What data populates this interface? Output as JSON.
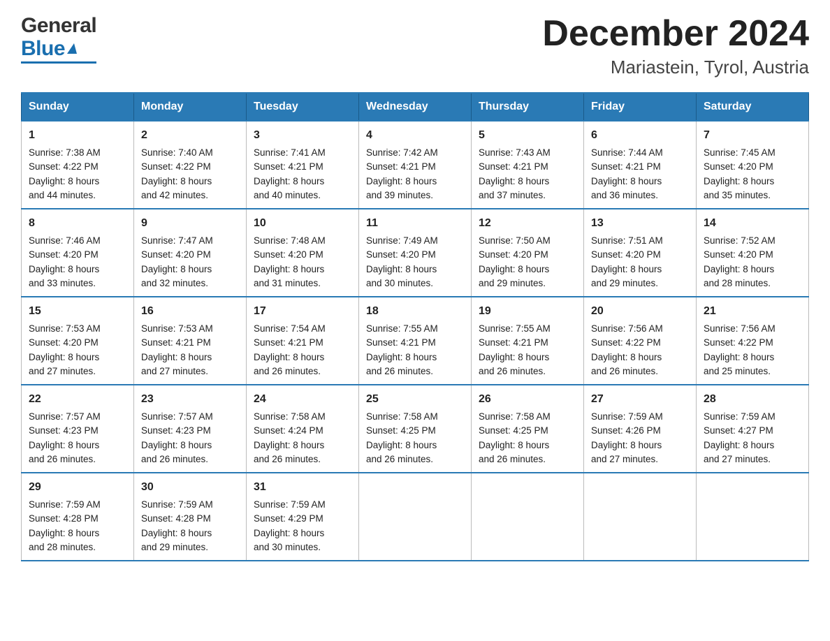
{
  "logo": {
    "general": "General",
    "blue": "Blue"
  },
  "header": {
    "month": "December 2024",
    "location": "Mariastein, Tyrol, Austria"
  },
  "weekdays": [
    "Sunday",
    "Monday",
    "Tuesday",
    "Wednesday",
    "Thursday",
    "Friday",
    "Saturday"
  ],
  "weeks": [
    [
      {
        "day": "1",
        "sunrise": "7:38 AM",
        "sunset": "4:22 PM",
        "daylight": "8 hours and 44 minutes."
      },
      {
        "day": "2",
        "sunrise": "7:40 AM",
        "sunset": "4:22 PM",
        "daylight": "8 hours and 42 minutes."
      },
      {
        "day": "3",
        "sunrise": "7:41 AM",
        "sunset": "4:21 PM",
        "daylight": "8 hours and 40 minutes."
      },
      {
        "day": "4",
        "sunrise": "7:42 AM",
        "sunset": "4:21 PM",
        "daylight": "8 hours and 39 minutes."
      },
      {
        "day": "5",
        "sunrise": "7:43 AM",
        "sunset": "4:21 PM",
        "daylight": "8 hours and 37 minutes."
      },
      {
        "day": "6",
        "sunrise": "7:44 AM",
        "sunset": "4:21 PM",
        "daylight": "8 hours and 36 minutes."
      },
      {
        "day": "7",
        "sunrise": "7:45 AM",
        "sunset": "4:20 PM",
        "daylight": "8 hours and 35 minutes."
      }
    ],
    [
      {
        "day": "8",
        "sunrise": "7:46 AM",
        "sunset": "4:20 PM",
        "daylight": "8 hours and 33 minutes."
      },
      {
        "day": "9",
        "sunrise": "7:47 AM",
        "sunset": "4:20 PM",
        "daylight": "8 hours and 32 minutes."
      },
      {
        "day": "10",
        "sunrise": "7:48 AM",
        "sunset": "4:20 PM",
        "daylight": "8 hours and 31 minutes."
      },
      {
        "day": "11",
        "sunrise": "7:49 AM",
        "sunset": "4:20 PM",
        "daylight": "8 hours and 30 minutes."
      },
      {
        "day": "12",
        "sunrise": "7:50 AM",
        "sunset": "4:20 PM",
        "daylight": "8 hours and 29 minutes."
      },
      {
        "day": "13",
        "sunrise": "7:51 AM",
        "sunset": "4:20 PM",
        "daylight": "8 hours and 29 minutes."
      },
      {
        "day": "14",
        "sunrise": "7:52 AM",
        "sunset": "4:20 PM",
        "daylight": "8 hours and 28 minutes."
      }
    ],
    [
      {
        "day": "15",
        "sunrise": "7:53 AM",
        "sunset": "4:20 PM",
        "daylight": "8 hours and 27 minutes."
      },
      {
        "day": "16",
        "sunrise": "7:53 AM",
        "sunset": "4:21 PM",
        "daylight": "8 hours and 27 minutes."
      },
      {
        "day": "17",
        "sunrise": "7:54 AM",
        "sunset": "4:21 PM",
        "daylight": "8 hours and 26 minutes."
      },
      {
        "day": "18",
        "sunrise": "7:55 AM",
        "sunset": "4:21 PM",
        "daylight": "8 hours and 26 minutes."
      },
      {
        "day": "19",
        "sunrise": "7:55 AM",
        "sunset": "4:21 PM",
        "daylight": "8 hours and 26 minutes."
      },
      {
        "day": "20",
        "sunrise": "7:56 AM",
        "sunset": "4:22 PM",
        "daylight": "8 hours and 26 minutes."
      },
      {
        "day": "21",
        "sunrise": "7:56 AM",
        "sunset": "4:22 PM",
        "daylight": "8 hours and 25 minutes."
      }
    ],
    [
      {
        "day": "22",
        "sunrise": "7:57 AM",
        "sunset": "4:23 PM",
        "daylight": "8 hours and 26 minutes."
      },
      {
        "day": "23",
        "sunrise": "7:57 AM",
        "sunset": "4:23 PM",
        "daylight": "8 hours and 26 minutes."
      },
      {
        "day": "24",
        "sunrise": "7:58 AM",
        "sunset": "4:24 PM",
        "daylight": "8 hours and 26 minutes."
      },
      {
        "day": "25",
        "sunrise": "7:58 AM",
        "sunset": "4:25 PM",
        "daylight": "8 hours and 26 minutes."
      },
      {
        "day": "26",
        "sunrise": "7:58 AM",
        "sunset": "4:25 PM",
        "daylight": "8 hours and 26 minutes."
      },
      {
        "day": "27",
        "sunrise": "7:59 AM",
        "sunset": "4:26 PM",
        "daylight": "8 hours and 27 minutes."
      },
      {
        "day": "28",
        "sunrise": "7:59 AM",
        "sunset": "4:27 PM",
        "daylight": "8 hours and 27 minutes."
      }
    ],
    [
      {
        "day": "29",
        "sunrise": "7:59 AM",
        "sunset": "4:28 PM",
        "daylight": "8 hours and 28 minutes."
      },
      {
        "day": "30",
        "sunrise": "7:59 AM",
        "sunset": "4:28 PM",
        "daylight": "8 hours and 29 minutes."
      },
      {
        "day": "31",
        "sunrise": "7:59 AM",
        "sunset": "4:29 PM",
        "daylight": "8 hours and 30 minutes."
      },
      null,
      null,
      null,
      null
    ]
  ],
  "labels": {
    "sunrise": "Sunrise:",
    "sunset": "Sunset:",
    "daylight": "Daylight:"
  }
}
